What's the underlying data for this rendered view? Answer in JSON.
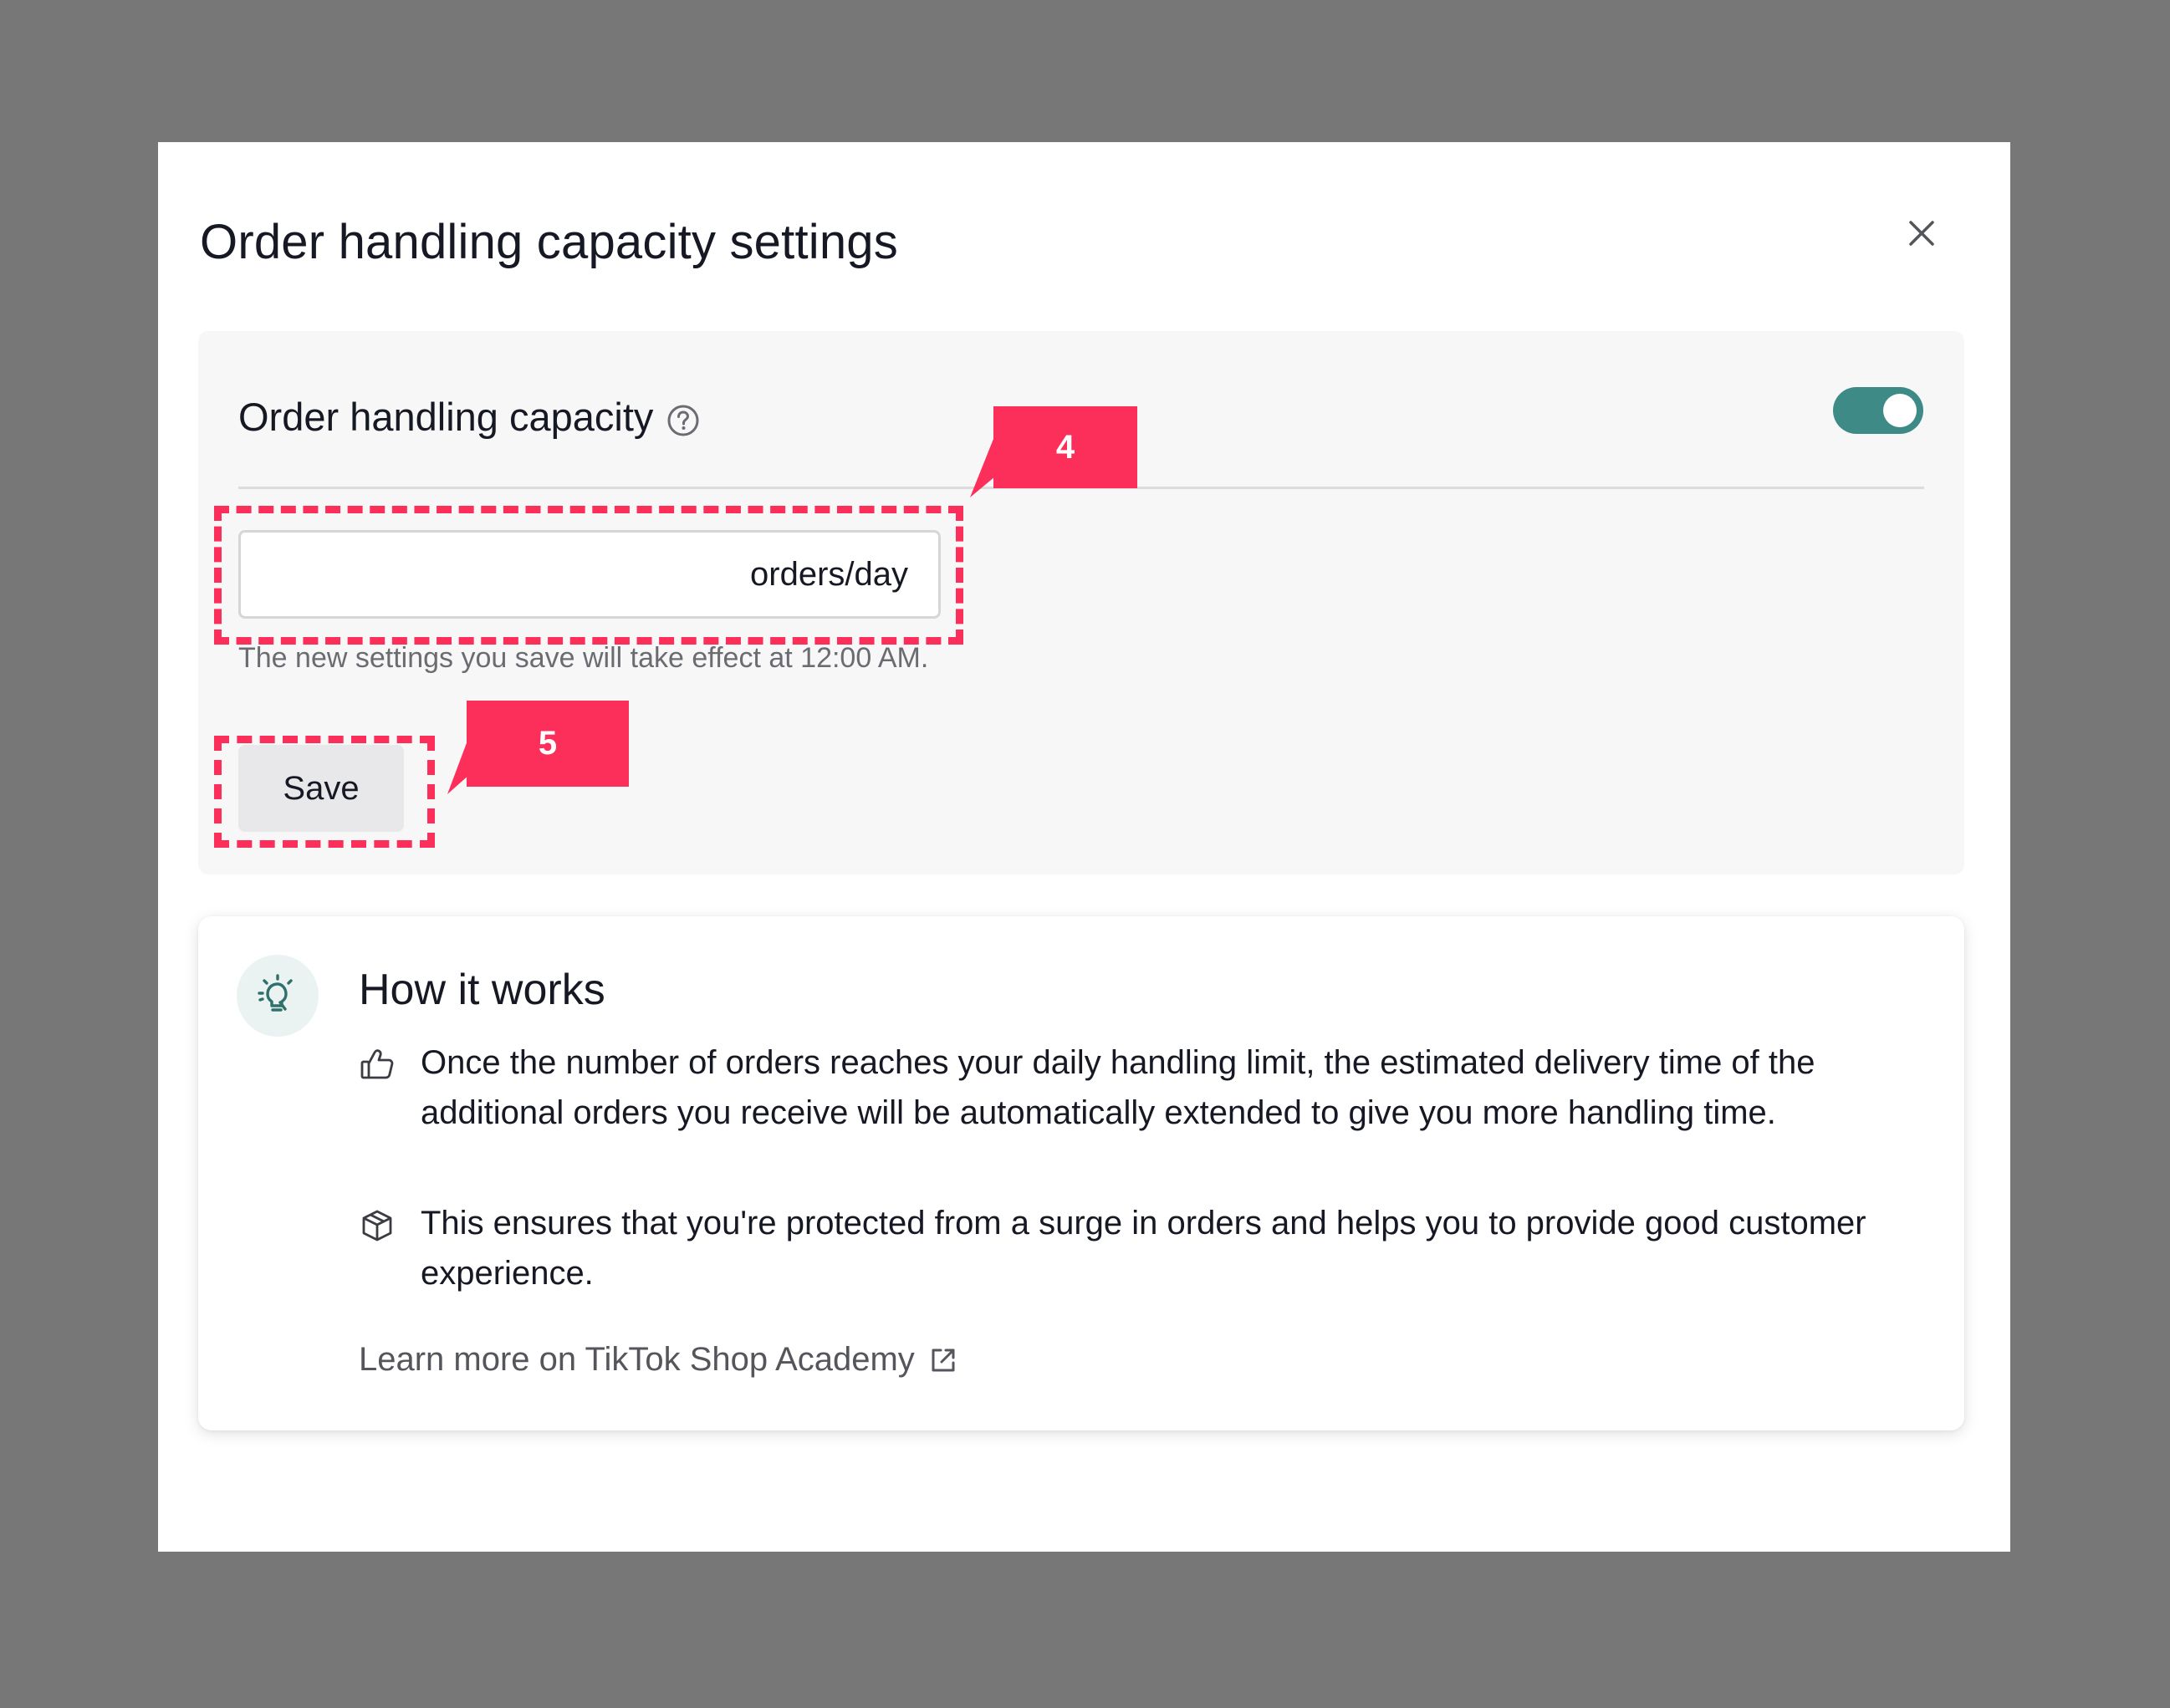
{
  "modal": {
    "title": "Order handling capacity settings",
    "close_icon": "close-icon"
  },
  "settings": {
    "label": "Order handling capacity",
    "help_icon": "question-circle-icon",
    "toggle_on": true,
    "input_value": "",
    "unit": "orders/day",
    "hint": "The new settings you save will take effect at 12:00 AM.",
    "save_label": "Save"
  },
  "how_it_works": {
    "icon": "lightbulb-icon",
    "title": "How it works",
    "items": [
      {
        "icon": "thumbs-up-icon",
        "text": "Once the number of orders reaches your daily handling limit, the estimated delivery time of the additional orders you receive will be automatically extended to give you more handling time."
      },
      {
        "icon": "package-box-icon",
        "text": "This ensures that you're protected from a surge in orders and helps you to provide good customer experience."
      }
    ],
    "link_label": "Learn more on TikTok Shop Academy",
    "link_icon": "external-link-icon"
  },
  "annotations": {
    "step_input": "4",
    "step_save": "5",
    "color": "#fc2f5a"
  },
  "colors": {
    "backdrop": "#777777",
    "toggle_accent": "#3d8a87"
  }
}
